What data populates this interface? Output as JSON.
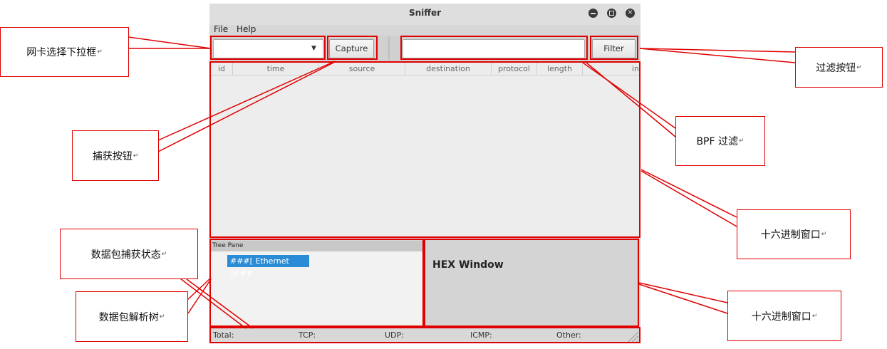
{
  "window": {
    "title": "Sniffer"
  },
  "menu": {
    "file": "File",
    "help": "Help"
  },
  "toolbar": {
    "capture_label": "Capture",
    "filter_label": "Filter"
  },
  "table": {
    "columns": [
      "id",
      "time",
      "source",
      "destination",
      "protocol",
      "length",
      "in"
    ]
  },
  "tree_pane": {
    "header": "Tree Pane",
    "root_node": "###[ Ethernet ]###"
  },
  "hex_pane": {
    "label": "HEX Window"
  },
  "status": {
    "total": "Total:",
    "tcp": "TCP:",
    "udp": "UDP:",
    "icmp": "ICMP:",
    "other": "Other:"
  },
  "annotations": {
    "nic_dropdown": "网卡选择下拉框",
    "capture_button": "捕获按钮",
    "filter_button": "过滤按钮",
    "bpf_filter": "BPF 过滤",
    "packet_list": "十六进制窗口",
    "capture_status": "数据包捕获状态",
    "parse_tree": "数据包解析树",
    "hex_window": "十六进制窗口",
    "return_mark": "↵"
  },
  "colors": {
    "annotation_red": "#e00000",
    "tree_highlight": "#2a8bd6"
  }
}
